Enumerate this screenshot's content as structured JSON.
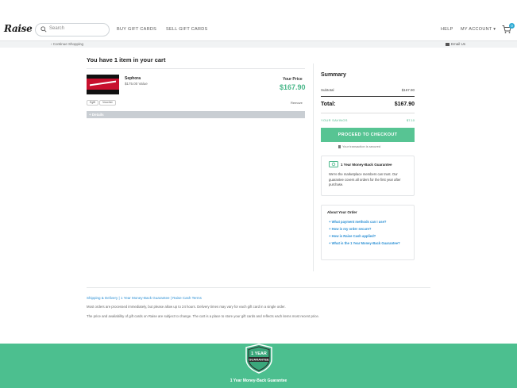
{
  "header": {
    "logo": "Raise",
    "search_placeholder": "Search",
    "nav": [
      "BUY GIFT CARDS",
      "SELL GIFT CARDS"
    ],
    "help": "HELP",
    "account": "MY ACCOUNT ▾",
    "cart_count": "0"
  },
  "subbar": {
    "continue_shopping": "‹ Continue Shopping",
    "email_us": "Email Us"
  },
  "cart": {
    "title": "You have 1 item in your cart",
    "item": {
      "name": "Sephora",
      "value": "$175.00 Value",
      "price_label": "Your Price",
      "price": "$167.90",
      "tags": [
        "Egift",
        "Voucher"
      ],
      "remove": "Remove"
    },
    "details": "+ Details"
  },
  "summary": {
    "title": "Summary",
    "subtotal_label": "Subtotal",
    "subtotal_value": "$167.90",
    "total_label": "Total:",
    "total_value": "$167.90",
    "savings_label": "YOUR SAVINGS",
    "savings_value": "$7.10",
    "checkout": "PROCEED TO CHECKOUT",
    "secure": "Your transaction is secured"
  },
  "guarantee": {
    "title": "1 Year Money-Back Guarantee",
    "text": "We're the marketplace members can trust. Our guarantee covers all orders for the first year after purchase."
  },
  "about": {
    "title": "About Your Order",
    "links": [
      "+ What payment methods can I use?",
      "+ How is my order secure?",
      "+ How is Raise Cash applied?",
      "+ What is the 1 Year Money-Back Guarantee?"
    ]
  },
  "footer": {
    "links": "Shipping & Delivery | 1 Year Money-Back Guarantee | Raise Cash Terms",
    "p1": "Most orders are processed immediately, but please allow up to 24 hours. Delivery times may vary for each gift card in a single order.",
    "p2": "The price and availability of gift cards on Raise are subject to change. The cart is a place to store your gift cards and reflects each items most recent price."
  },
  "banner": {
    "badge_line1": "1 YEAR",
    "badge_line2": "GUARANTEE",
    "text": "1 Year Money-Back Guarantee"
  },
  "colors": {
    "accent_green": "#4cbf8f",
    "link_blue": "#2a8fd4",
    "price_green": "#4ab78a"
  }
}
